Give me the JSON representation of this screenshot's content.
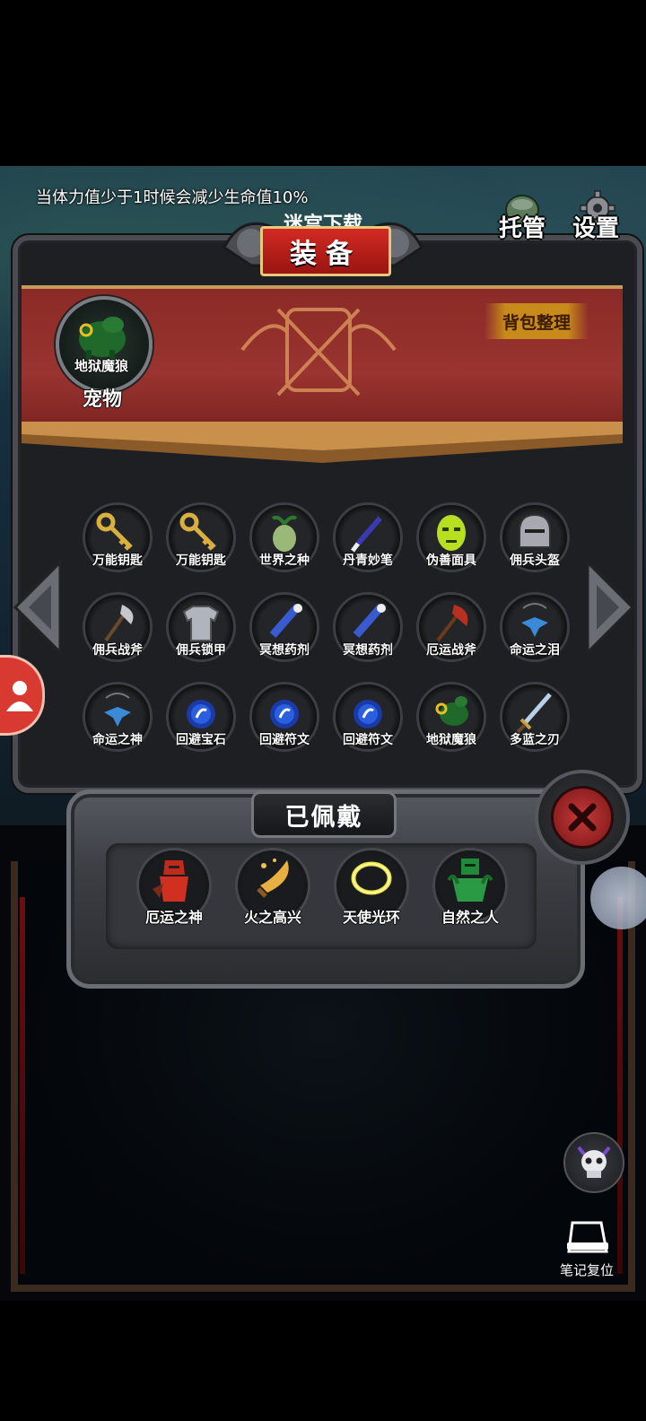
{
  "hint": "当体力值少于1时候会减少生命值10%",
  "top_buttons": {
    "auto_label": "托管",
    "settings_label": "设置"
  },
  "title": {
    "behind_text": "迷宫下载",
    "main": "装备"
  },
  "sort_button": "背包整理",
  "pet": {
    "name": "地狱魔狼",
    "label": "宠物"
  },
  "inventory": [
    {
      "name": "万能钥匙",
      "icon": "key-icon"
    },
    {
      "name": "万能钥匙",
      "icon": "key-icon"
    },
    {
      "name": "世界之种",
      "icon": "seed-icon"
    },
    {
      "name": "丹青妙笔",
      "icon": "brush-icon"
    },
    {
      "name": "伪善面具",
      "icon": "mask-icon"
    },
    {
      "name": "佣兵头盔",
      "icon": "helmet-icon"
    },
    {
      "name": "佣兵战斧",
      "icon": "axe-icon"
    },
    {
      "name": "佣兵锁甲",
      "icon": "chainmail-icon"
    },
    {
      "name": "冥想药剂",
      "icon": "potion-icon"
    },
    {
      "name": "冥想药剂",
      "icon": "potion-icon"
    },
    {
      "name": "厄运战斧",
      "icon": "red-axe-icon"
    },
    {
      "name": "命运之泪",
      "icon": "amulet-icon"
    },
    {
      "name": "命运之神",
      "icon": "amulet-icon"
    },
    {
      "name": "回避宝石",
      "icon": "blue-gem-icon"
    },
    {
      "name": "回避符文",
      "icon": "blue-gem-icon"
    },
    {
      "name": "回避符文",
      "icon": "blue-gem-icon"
    },
    {
      "name": "地狱魔狼",
      "icon": "wolf-icon"
    },
    {
      "name": "多蓝之刃",
      "icon": "sword-icon"
    }
  ],
  "worn": {
    "title": "已佩戴",
    "items": [
      {
        "name": "厄运之神",
        "icon": "red-knight-icon"
      },
      {
        "name": "火之高兴",
        "icon": "fire-blade-icon"
      },
      {
        "name": "天使光环",
        "icon": "halo-icon"
      },
      {
        "name": "自然之人",
        "icon": "green-golem-icon"
      }
    ]
  },
  "notes_label": "笔记复位",
  "colors": {
    "banner_red": "#9a3430",
    "gold": "#c88a1a",
    "close_red": "#c43a3a",
    "side_tab": "#d83a32"
  }
}
